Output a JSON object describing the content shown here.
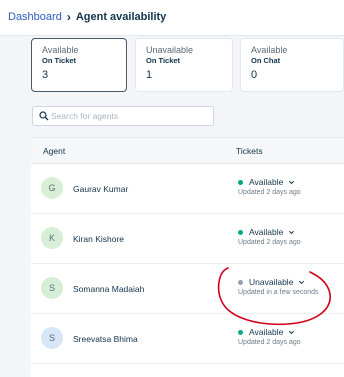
{
  "breadcrumb": {
    "root": "Dashboard",
    "current": "Agent availability"
  },
  "cards": [
    {
      "title": "Available",
      "subtitle": "On Ticket",
      "count": "3"
    },
    {
      "title": "Unavailable",
      "subtitle": "On Ticket",
      "count": "1"
    },
    {
      "title": "Available",
      "subtitle": "On Chat",
      "count": "0"
    }
  ],
  "search": {
    "placeholder": "Search for agents",
    "icon": "search-icon"
  },
  "table": {
    "columns": [
      "Agent",
      "Tickets"
    ],
    "rows": [
      {
        "initial": "G",
        "name": "Gaurav Kumar",
        "status": "Available",
        "updated": "Updated 2 days ago"
      },
      {
        "initial": "K",
        "name": "Kiran Kishore",
        "status": "Available",
        "updated": "Updated 2 days ago"
      },
      {
        "initial": "S",
        "name": "Somanna Madaiah",
        "status": "Unavailable",
        "updated": "Updated in a few seconds"
      },
      {
        "initial": "S",
        "name": "Sreevatsa Bhima",
        "status": "Available",
        "updated": "Updated 2 days ago"
      }
    ]
  },
  "colors": {
    "available": "#00a886",
    "unavailable": "#92a2b1",
    "link": "#2c5cc5",
    "annotation": "#d0021b",
    "avatar_green": "#d6efd6",
    "avatar_blue": "#d6e6f7"
  }
}
